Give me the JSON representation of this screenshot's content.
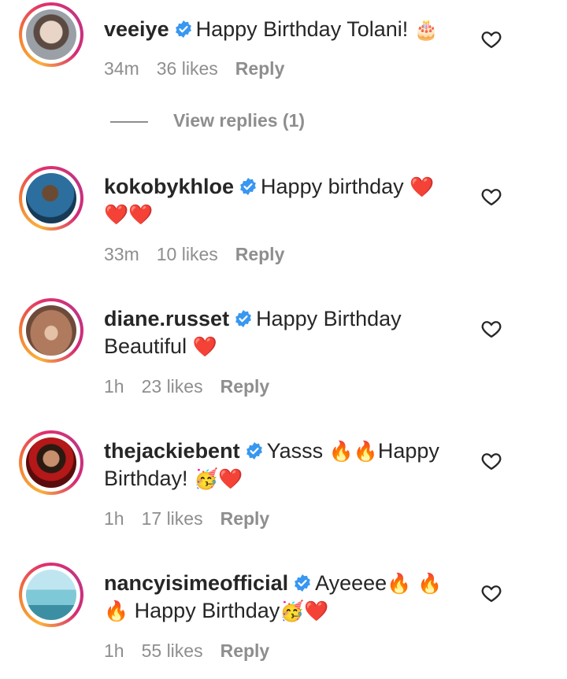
{
  "comments": [
    {
      "username": "veeiye",
      "text_parts": [
        "Happy Birthday Tolani! ",
        "🎂"
      ],
      "time": "34m",
      "likes": "36 likes",
      "reply": "Reply",
      "avatar_colors": [
        "#9aa0a6",
        "#5a4a42"
      ]
    },
    {
      "username": "kokobykhloe",
      "text_parts": [
        "Happy birthday ",
        "❤️",
        "❤️❤️"
      ],
      "time": "33m",
      "likes": "10 likes",
      "reply": "Reply",
      "avatar_colors": [
        "#2c6f9e",
        "#173a56"
      ]
    },
    {
      "username": "diane.russet",
      "text_parts": [
        "Happy Birthday",
        "Beautiful ",
        "❤️"
      ],
      "time": "1h",
      "likes": "23 likes",
      "reply": "Reply",
      "avatar_colors": [
        "#b07a5e",
        "#6d4a3a"
      ]
    },
    {
      "username": "thejackiebent",
      "text_parts": [
        "Yasss ",
        "🔥🔥",
        "Happy",
        "Birthday! ",
        "🥳❤️"
      ],
      "time": "1h",
      "likes": "17 likes",
      "reply": "Reply",
      "avatar_colors": [
        "#b41818",
        "#5a0c0c"
      ]
    },
    {
      "username": "nancyisimeofficial",
      "text_parts": [
        "Ayeeee",
        "🔥 🔥",
        "🔥",
        " Happy Birthday",
        "🥳❤️"
      ],
      "time": "1h",
      "likes": "55 likes",
      "reply": "Reply",
      "avatar_colors": [
        "#7fc8d8",
        "#3c8fa3"
      ]
    }
  ],
  "view_replies": "View replies (1)",
  "colors": {
    "verified": "#3897f0",
    "secondary_text": "#8e8e8e",
    "primary_text": "#262626"
  },
  "icons": {
    "like": "heart-outline-icon",
    "verified": "verified-badge-icon"
  }
}
